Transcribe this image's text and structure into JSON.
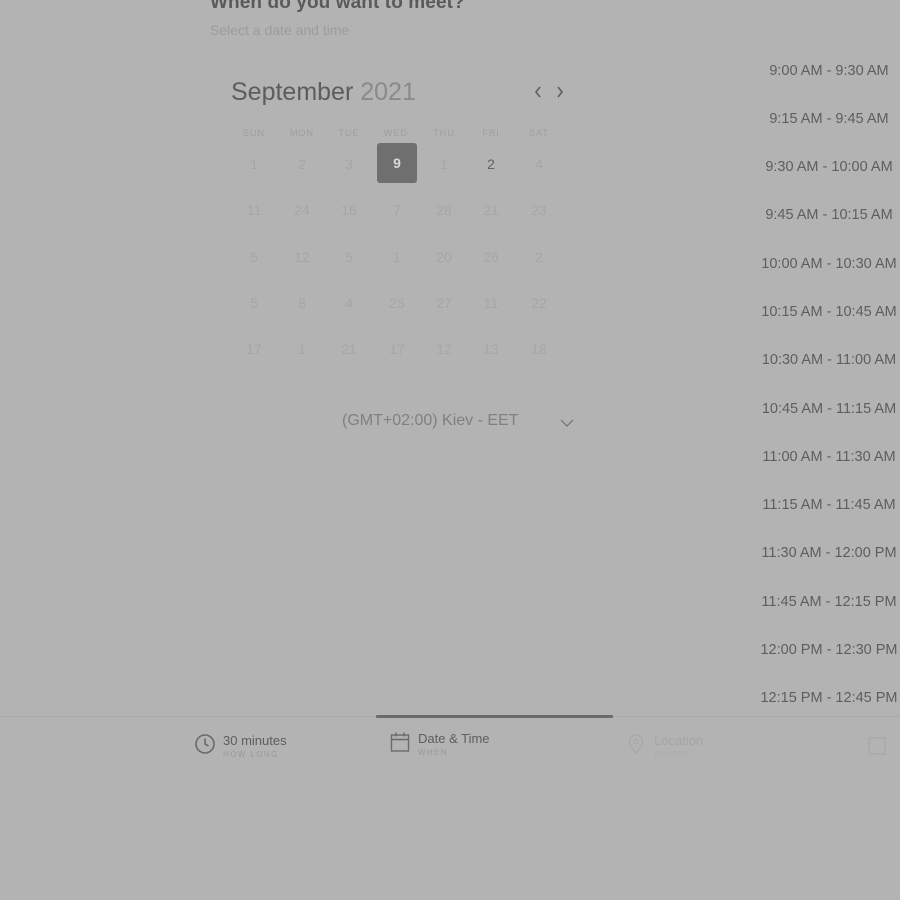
{
  "header": {
    "title": "When do you want to meet?",
    "subtitle": "Select a date and time"
  },
  "calendar": {
    "month": "September",
    "year": "2021",
    "weekdays": [
      "SUN",
      "MON",
      "TUE",
      "WED",
      "THU",
      "FRI",
      "SAT"
    ],
    "weeks": [
      [
        "1",
        "2",
        "3",
        "9",
        "1",
        "2",
        "4"
      ],
      [
        "11",
        "24",
        "16",
        "7",
        "28",
        "21",
        "23"
      ],
      [
        "5",
        "12",
        "5",
        "1",
        "20",
        "26",
        "2"
      ],
      [
        "5",
        "8",
        "4",
        "25",
        "27",
        "11",
        "22"
      ],
      [
        "17",
        "1",
        "21",
        "17",
        "12",
        "13",
        "18"
      ]
    ],
    "selected_day": "9",
    "available_day": "2"
  },
  "timezone": {
    "label": "(GMT+02:00) Kiev - EET"
  },
  "time_slots": [
    "9:00 AM - 9:30 AM",
    "9:15 AM - 9:45 AM",
    "9:30 AM - 10:00 AM",
    "9:45 AM - 10:15 AM",
    "10:00 AM - 10:30 AM",
    "10:15 AM - 10:45 AM",
    "10:30 AM - 11:00 AM",
    "10:45 AM - 11:15 AM",
    "11:00 AM - 11:30 AM",
    "11:15 AM - 11:45 AM",
    "11:30 AM - 12:00 PM",
    "11:45 AM - 12:15 PM",
    "12:00 PM - 12:30 PM",
    "12:15 PM - 12:45 PM"
  ],
  "steps": [
    {
      "title": "30 minutes",
      "subtitle": "HOW LONG",
      "icon": "clock-icon"
    },
    {
      "title": "Date & Time",
      "subtitle": "WHEN",
      "icon": "calendar-icon"
    },
    {
      "title": "Location",
      "subtitle": "WHERE",
      "icon": "location-pin-icon"
    }
  ],
  "colors": {
    "overlay_background": "#b3b3b3",
    "selected_day": "#6f6f6f",
    "progress": "#6b6b6b"
  }
}
